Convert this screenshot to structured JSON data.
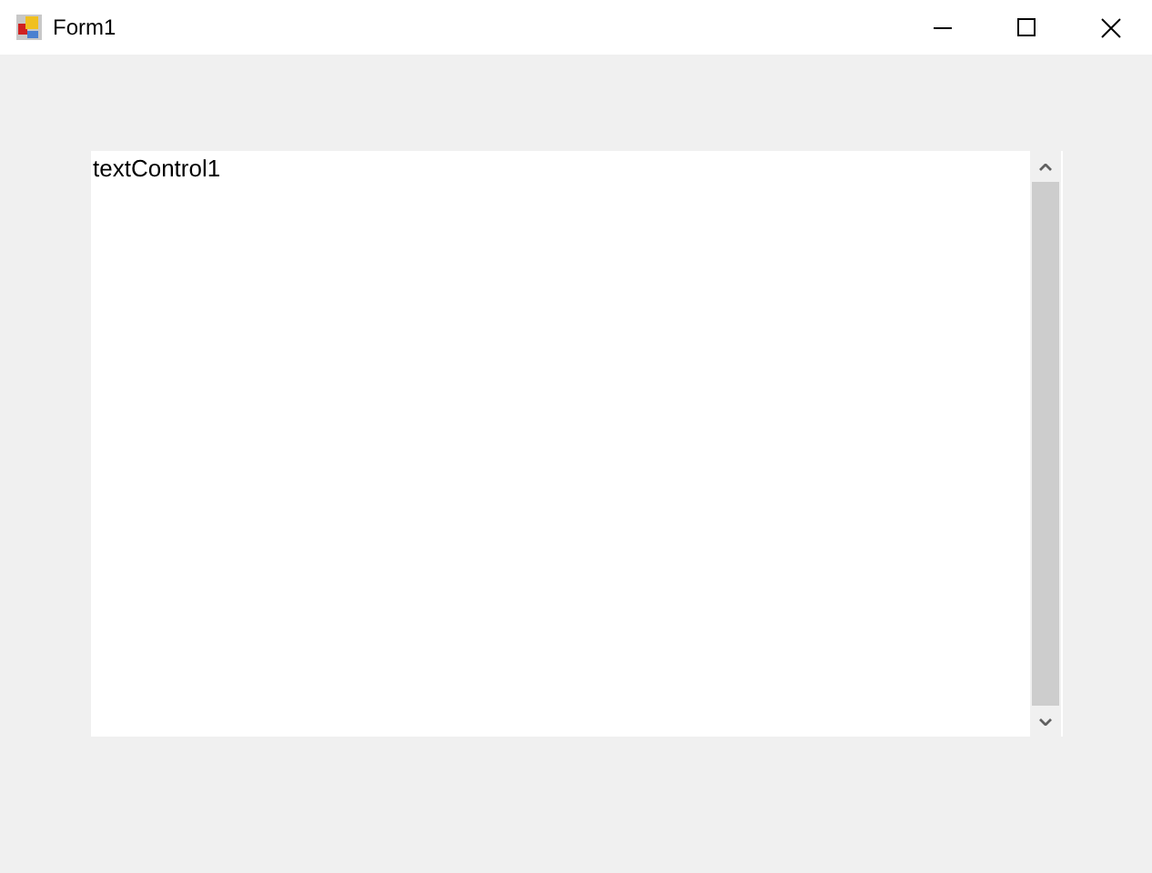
{
  "window": {
    "title": "Form1"
  },
  "text_control": {
    "value": "textControl1"
  }
}
